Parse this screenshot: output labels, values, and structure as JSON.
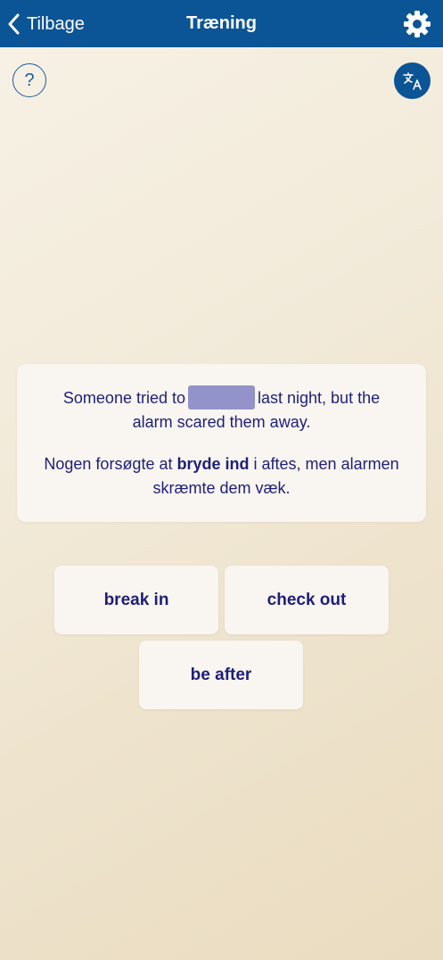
{
  "nav": {
    "back_label": "Tilbage",
    "title": "Træning",
    "back_icon": "chevron-left-icon",
    "settings_icon": "gear-icon"
  },
  "controls": {
    "help_label": "?",
    "translate_icon": "translate-icon"
  },
  "exercise": {
    "en_before": "Someone tried to",
    "en_after": "last night, but the alarm scared them away.",
    "da_before": "Nogen forsøgte at",
    "da_bold": "bryde ind",
    "da_after": "i aftes, men alarmen skræmte dem væk."
  },
  "options": [
    {
      "label": "break in"
    },
    {
      "label": "check out"
    },
    {
      "label": "be after"
    }
  ],
  "colors": {
    "navbar": "#0b5596",
    "text": "#1e1e7a",
    "blank": "#9393c9",
    "card": "#f9f6f1"
  }
}
